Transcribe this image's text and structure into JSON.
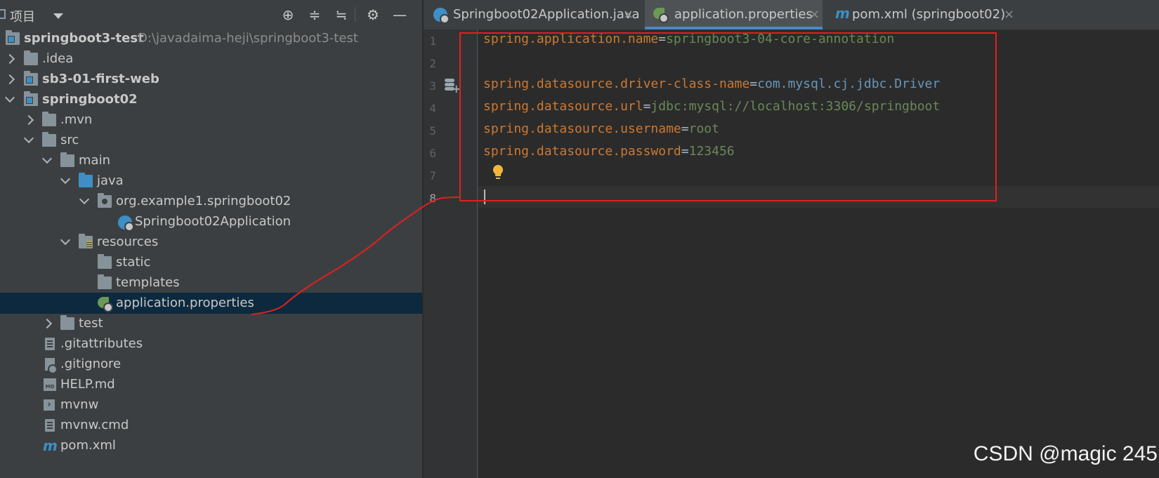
{
  "project_panel": {
    "title": "项目",
    "toolbar_icons": [
      "locate-icon",
      "expand-all-icon",
      "collapse-all-icon",
      "gear-icon",
      "minimize-icon"
    ],
    "tree": [
      {
        "label": "springboot3-test",
        "path": "D:\\javadaima-heji\\springboot3-test",
        "bold": true,
        "icon": "module-folder-icon",
        "arrow": "expanded"
      },
      {
        "label": ".idea",
        "icon": "folder-icon",
        "arrow": "collapsed"
      },
      {
        "label": "sb3-01-first-web",
        "bold": true,
        "icon": "module-folder-icon",
        "arrow": "collapsed"
      },
      {
        "label": "springboot02",
        "bold": true,
        "icon": "module-folder-icon",
        "arrow": "expanded"
      },
      {
        "label": ".mvn",
        "icon": "folder-icon",
        "arrow": "collapsed"
      },
      {
        "label": "src",
        "icon": "folder-icon",
        "arrow": "expanded"
      },
      {
        "label": "main",
        "icon": "folder-icon",
        "arrow": "expanded"
      },
      {
        "label": "java",
        "icon": "source-folder-icon",
        "arrow": "expanded"
      },
      {
        "label": "org.example1.springboot02",
        "icon": "package-icon",
        "arrow": "expanded"
      },
      {
        "label": "Springboot02Application",
        "icon": "spring-boot-class-icon",
        "arrow": "none"
      },
      {
        "label": "resources",
        "icon": "resources-folder-icon",
        "arrow": "expanded"
      },
      {
        "label": "static",
        "icon": "folder-icon",
        "arrow": "none"
      },
      {
        "label": "templates",
        "icon": "folder-icon",
        "arrow": "none"
      },
      {
        "label": "application.properties",
        "icon": "spring-properties-icon",
        "arrow": "none",
        "selected": true
      },
      {
        "label": "test",
        "icon": "folder-icon",
        "arrow": "collapsed"
      },
      {
        "label": ".gitattributes",
        "icon": "text-file-icon",
        "arrow": "none"
      },
      {
        "label": ".gitignore",
        "icon": "gitignore-file-icon",
        "arrow": "none"
      },
      {
        "label": "HELP.md",
        "icon": "markdown-file-icon",
        "arrow": "none"
      },
      {
        "label": "mvnw",
        "icon": "shell-script-icon",
        "arrow": "none"
      },
      {
        "label": "mvnw.cmd",
        "icon": "text-file-icon",
        "arrow": "none"
      },
      {
        "label": "pom.xml",
        "icon": "maven-icon",
        "arrow": "none"
      }
    ]
  },
  "editor": {
    "tabs": [
      {
        "label": "Springboot02Application.java",
        "icon": "spring-boot-class-icon",
        "active": false
      },
      {
        "label": "application.properties",
        "icon": "spring-properties-icon",
        "active": true
      },
      {
        "label": "pom.xml (springboot02)",
        "icon": "maven-icon",
        "active": false
      }
    ],
    "lines": [
      {
        "num": "1",
        "key": "spring.application.name",
        "eq": "=",
        "value": "springboot3-04-core-annotation"
      },
      {
        "num": "2"
      },
      {
        "num": "3",
        "key": "spring.datasource.driver-class-name",
        "eq": "=",
        "value": "com.mysql.cj.jdbc.Driver"
      },
      {
        "num": "4",
        "key": "spring.datasource.url",
        "eq": "=",
        "value": "jdbc:mysql://localhost:3306/springboot"
      },
      {
        "num": "5",
        "key": "spring.datasource.username",
        "eq": "=",
        "value": "root"
      },
      {
        "num": "6",
        "key": "spring.datasource.password",
        "eq": "=",
        "value": "123456"
      },
      {
        "num": "7"
      },
      {
        "num": "8"
      }
    ],
    "colors": {
      "key": "#cc7832",
      "value": "#6a8759",
      "highlight_box": "#e0201e",
      "selection": "#0d293e"
    }
  },
  "watermark": "CSDN @magic 245"
}
